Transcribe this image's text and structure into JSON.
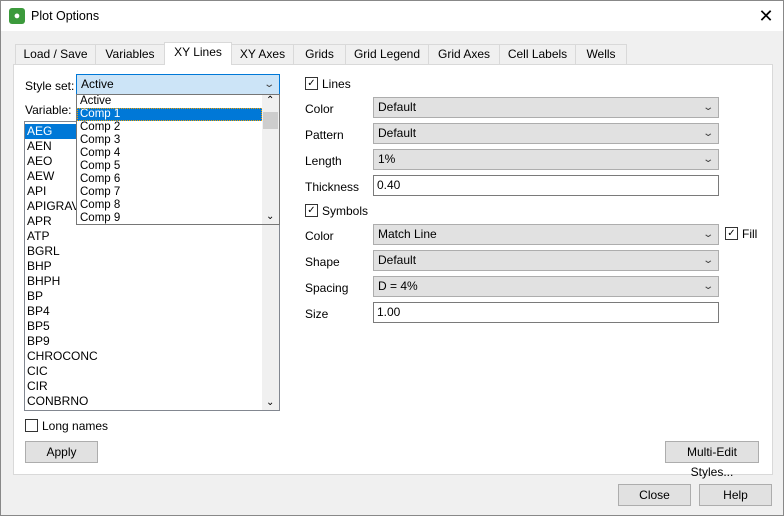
{
  "window": {
    "title": "Plot Options"
  },
  "tabs": [
    "Load / Save",
    "Variables",
    "XY Lines",
    "XY Axes",
    "Grids",
    "Grid Legend",
    "Grid Axes",
    "Cell Labels",
    "Wells"
  ],
  "active_tab": "XY Lines",
  "left": {
    "style_set_label": "Style set:",
    "style_set_value": "Active",
    "style_set_options": [
      "Active",
      "Comp 1",
      "Comp 2",
      "Comp 3",
      "Comp 4",
      "Comp 5",
      "Comp 6",
      "Comp 7",
      "Comp 8",
      "Comp 9"
    ],
    "variable_label": "Variable:",
    "variables": [
      "AEG",
      "AEN",
      "AEO",
      "AEW",
      "API",
      "APIGRAV",
      "APR",
      "ATP",
      "BGRL",
      "BHP",
      "BHPH",
      "BP",
      "BP4",
      "BP5",
      "BP9",
      "CHROCONC",
      "CIC",
      "CIR",
      "CONBRNO"
    ],
    "long_names_label": "Long names",
    "apply_label": "Apply"
  },
  "right": {
    "lines_label": "Lines",
    "line_color_label": "Color",
    "line_color_value": "Default",
    "pattern_label": "Pattern",
    "pattern_value": "Default",
    "length_label": "Length",
    "length_value": "1%",
    "thickness_label": "Thickness",
    "thickness_value": "0.40",
    "symbols_label": "Symbols",
    "sym_color_label": "Color",
    "sym_color_value": "Match Line",
    "fill_label": "Fill",
    "shape_label": "Shape",
    "shape_value": "Default",
    "spacing_label": "Spacing",
    "spacing_value": "D = 4%",
    "size_label": "Size",
    "size_value": "1.00",
    "multi_edit_label": "Multi-Edit Styles..."
  },
  "footer": {
    "close_label": "Close",
    "help_label": "Help"
  }
}
